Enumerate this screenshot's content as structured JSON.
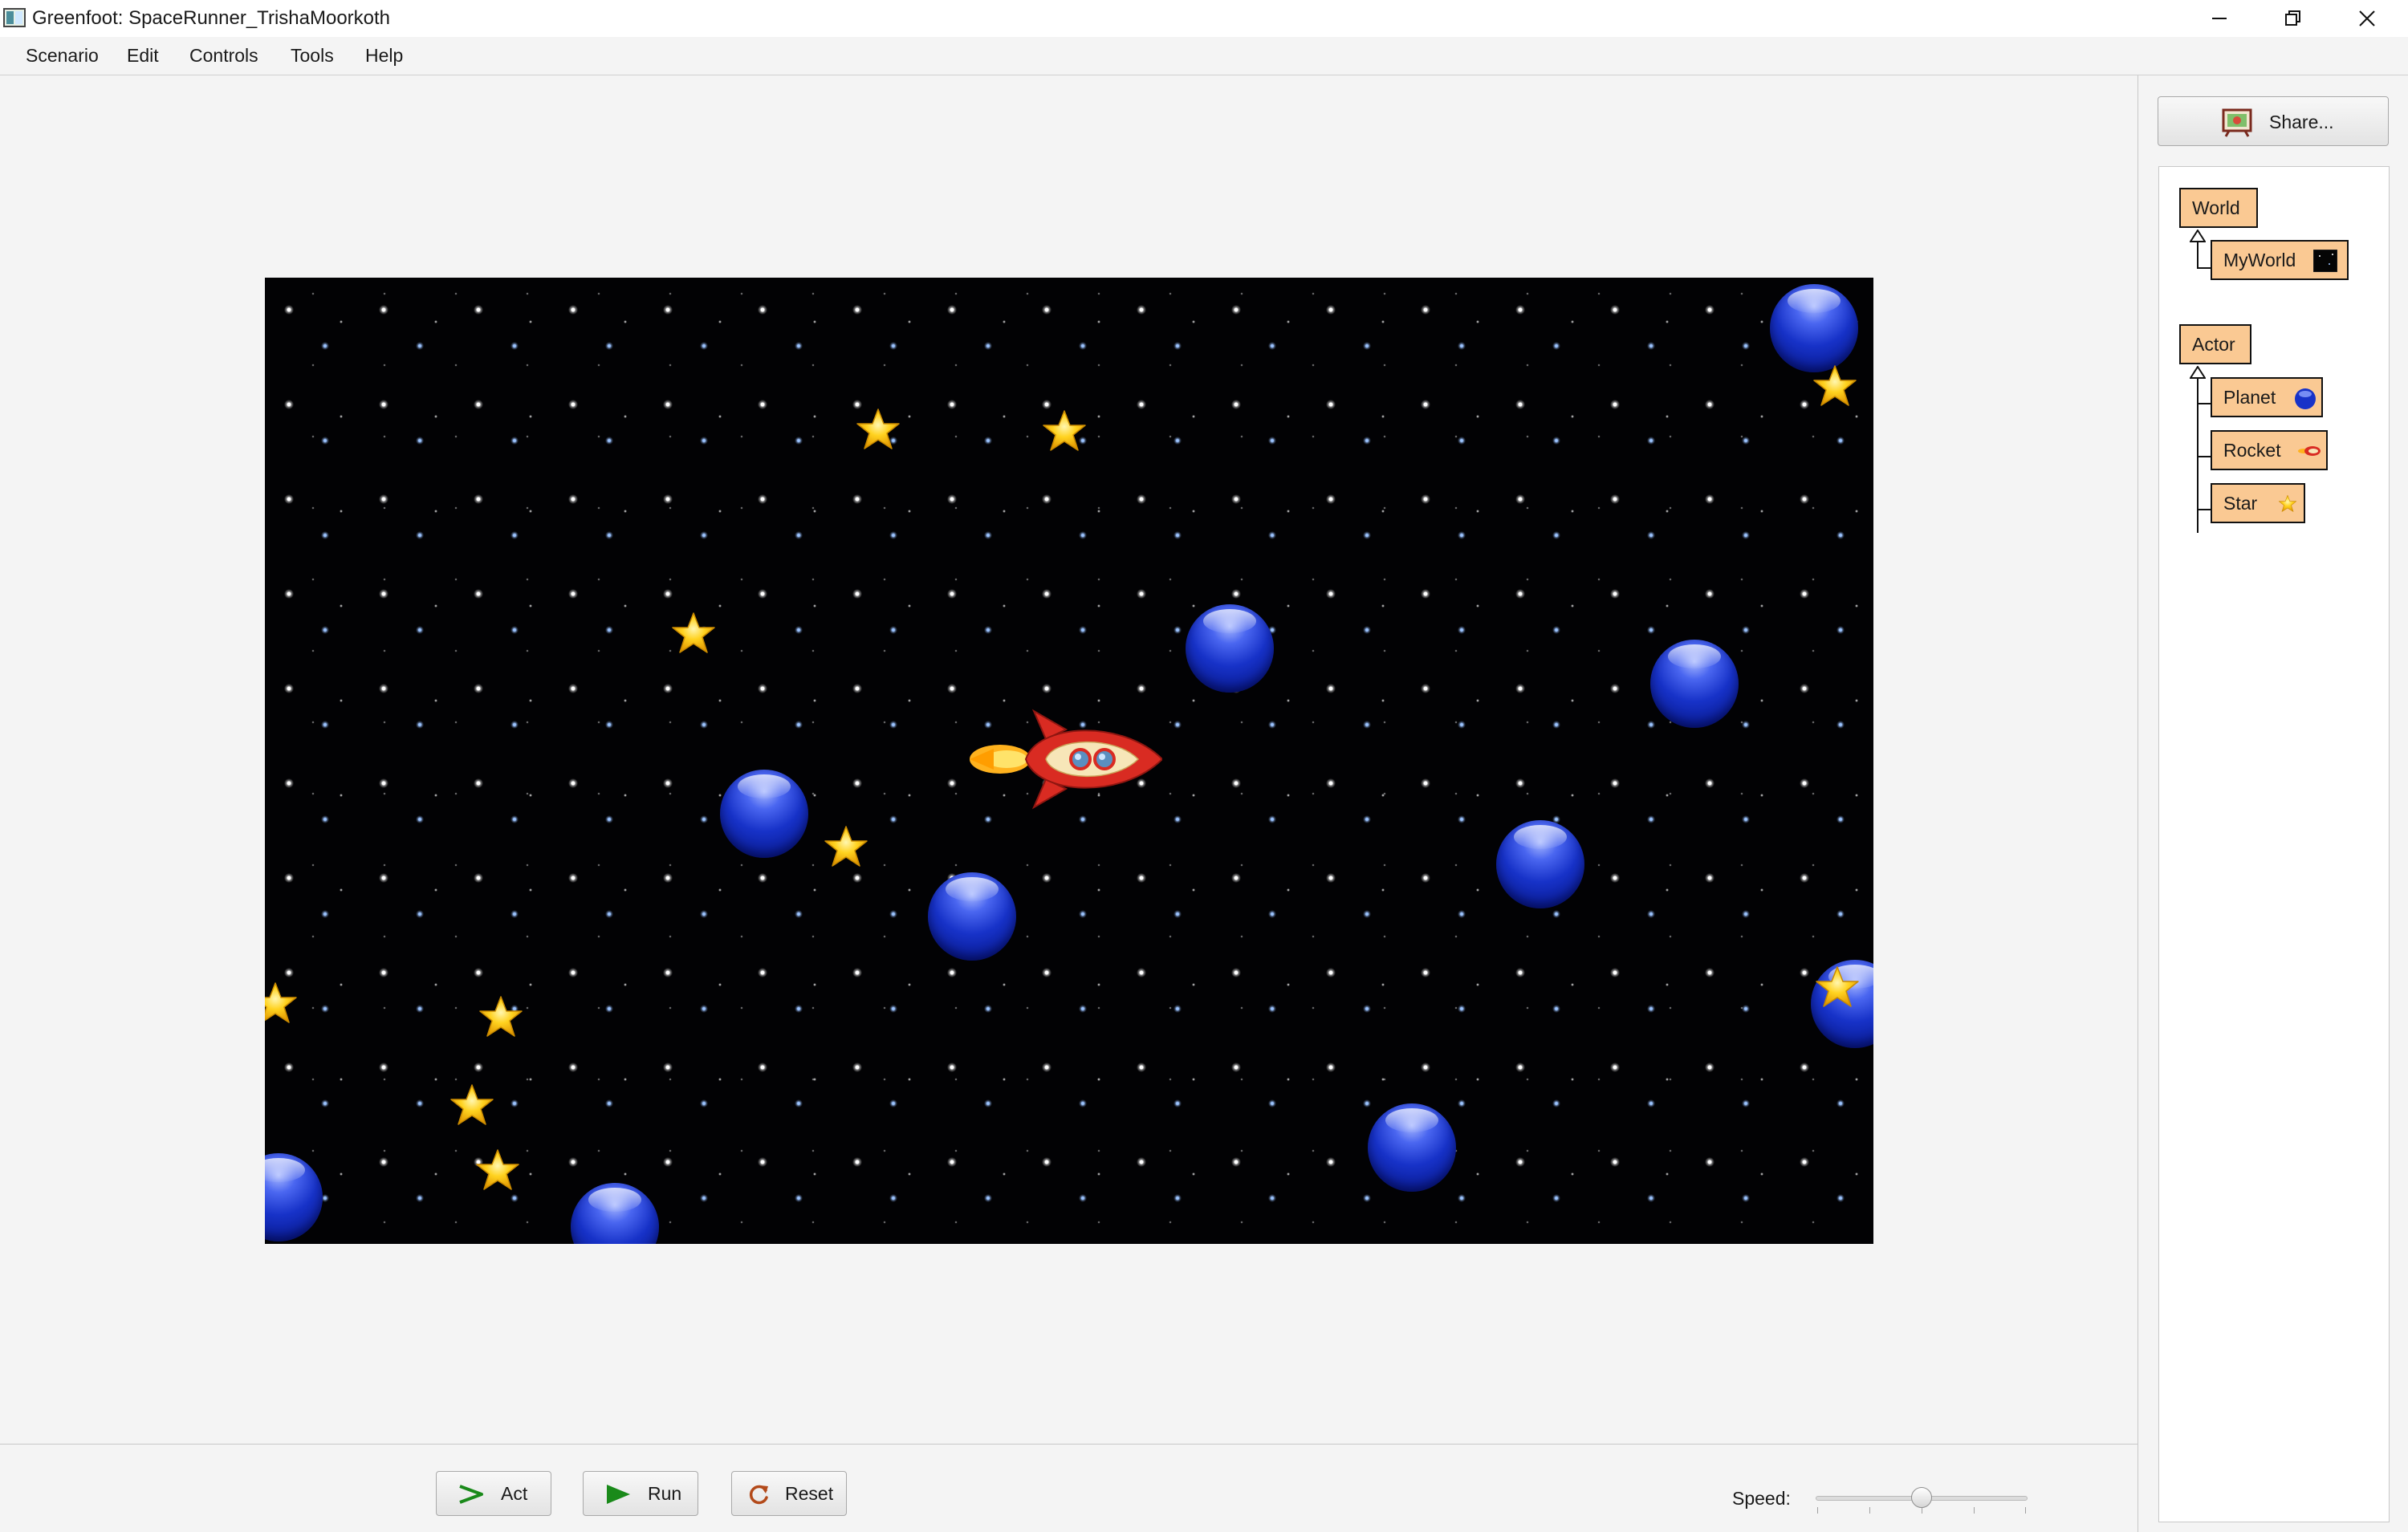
{
  "window": {
    "title": "Greenfoot: SpaceRunner_TrishaMoorkoth"
  },
  "menu": {
    "scenario": "Scenario",
    "edit": "Edit",
    "controls": "Controls",
    "tools": "Tools",
    "help": "Help"
  },
  "controls": {
    "act_label": "Act",
    "run_label": "Run",
    "reset_label": "Reset",
    "speed_label": "Speed:",
    "speed_value": 0.5
  },
  "sidebar": {
    "share_label": "Share...",
    "classes": {
      "world_root": "World",
      "world_subclass": "MyWorld",
      "actor_root": "Actor",
      "actor_subclasses": [
        "Planet",
        "Rocket",
        "Star"
      ]
    }
  },
  "colors": {
    "class_box": "#fac993",
    "world_background": "#020204",
    "planet": "#1732c8",
    "star": "#f7c21a",
    "rocket_body": "#d92b22",
    "run_green": "#1a8a1a"
  },
  "icons": {
    "app": "greenfoot-app-icon",
    "share": "share-icon",
    "act": "act-icon",
    "run": "play-icon",
    "reset": "reset-icon"
  }
}
